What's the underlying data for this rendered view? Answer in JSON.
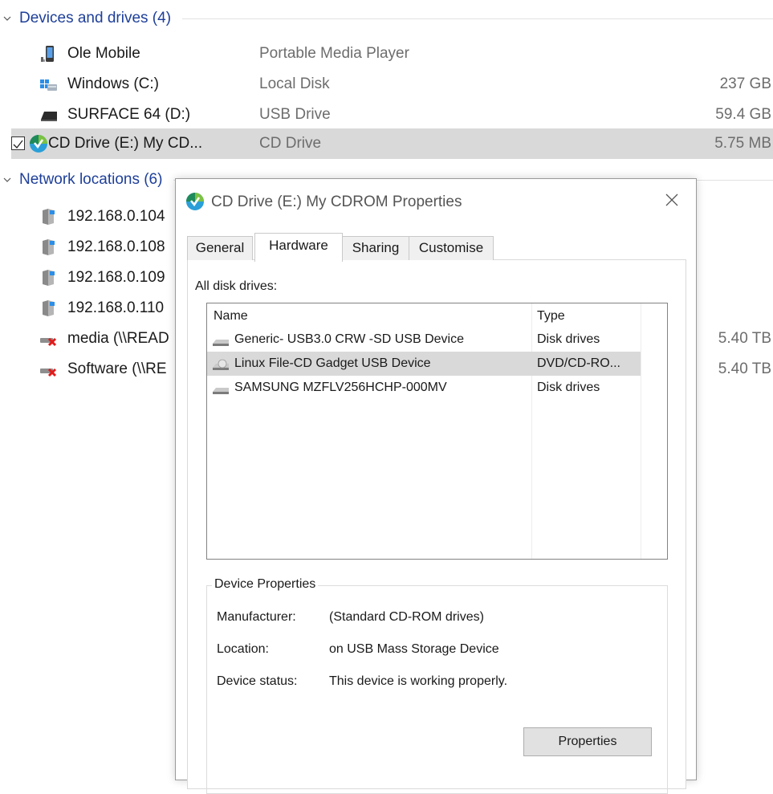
{
  "explorer": {
    "devices_group": {
      "title": "Devices and drives (4)"
    },
    "network_group": {
      "title": "Network locations (6)"
    },
    "devices": [
      {
        "name": "Ole Mobile",
        "type": "Portable Media Player",
        "size": "",
        "icon": "media-player-icon"
      },
      {
        "name": "Windows (C:)",
        "type": "Local Disk",
        "size": "237 GB",
        "icon": "windows-drive-icon"
      },
      {
        "name": "SURFACE 64 (D:)",
        "type": "USB Drive",
        "size": "59.4 GB",
        "icon": "usb-drive-icon"
      },
      {
        "name": "CD Drive (E:) My CD...",
        "type": "CD Drive",
        "size": "5.75 MB",
        "icon": "cd-drive-icon",
        "selected": true
      }
    ],
    "network": [
      {
        "name": "192.168.0.104",
        "size": ""
      },
      {
        "name": "192.168.0.108",
        "size": ""
      },
      {
        "name": "192.168.0.109",
        "size": ""
      },
      {
        "name": "192.168.0.110",
        "size": ""
      },
      {
        "name": "media (\\\\READ",
        "size": "5.40 TB"
      },
      {
        "name": "Software (\\\\RE",
        "size": "5.40 TB"
      }
    ]
  },
  "dialog": {
    "title": "CD Drive (E:) My CDROM Properties",
    "tabs": [
      "General",
      "Hardware",
      "Sharing",
      "Customise"
    ],
    "active_tab": "Hardware",
    "all_disks_label": "All disk drives:",
    "columns": {
      "name": "Name",
      "type": "Type"
    },
    "drives": [
      {
        "name": "Generic- USB3.0 CRW   -SD USB Device",
        "type": "Disk drives"
      },
      {
        "name": "Linux File-CD Gadget USB Device",
        "type": "DVD/CD-RO...",
        "selected": true
      },
      {
        "name": "SAMSUNG MZFLV256HCHP-000MV",
        "type": "Disk drives"
      }
    ],
    "device_properties": {
      "legend": "Device Properties",
      "manufacturer_label": "Manufacturer:",
      "manufacturer": "(Standard CD-ROM drives)",
      "location_label": "Location:",
      "location": "on USB Mass Storage Device",
      "status_label": "Device status:",
      "status": "This device is working properly.",
      "button": "Properties"
    }
  },
  "colors": {
    "group_title": "#1e3f9a",
    "selection": "#d9d9d9",
    "muted_text": "#6d6d6d"
  }
}
